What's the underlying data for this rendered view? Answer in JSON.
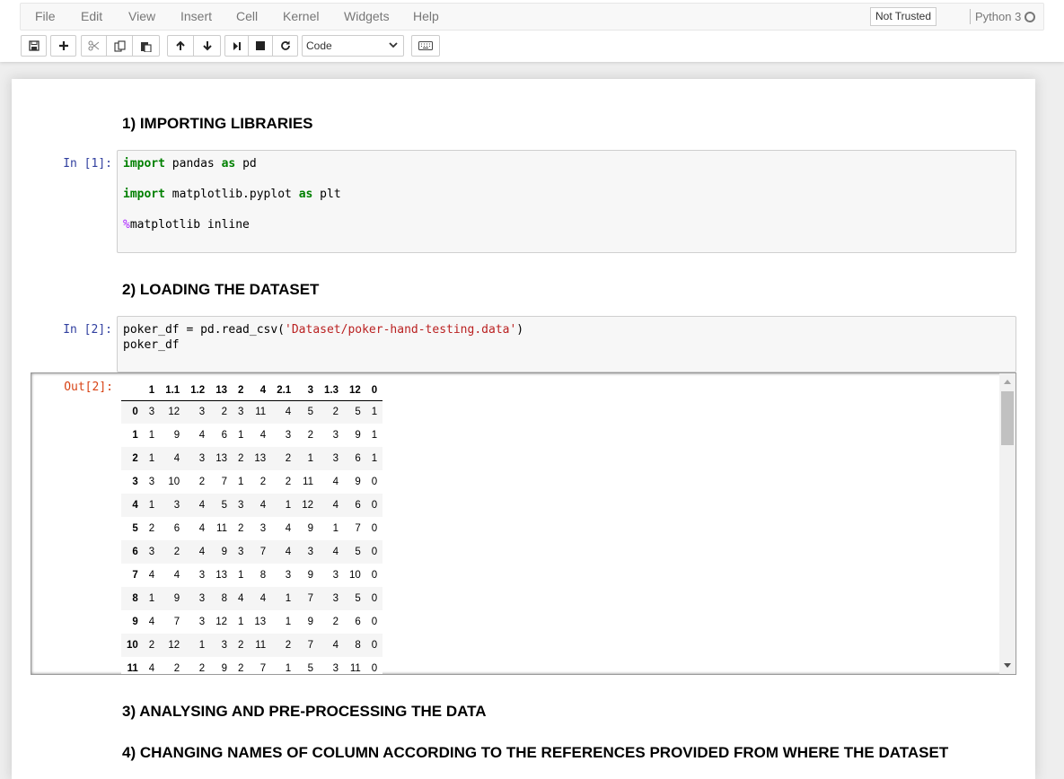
{
  "menu": {
    "items": [
      "File",
      "Edit",
      "View",
      "Insert",
      "Cell",
      "Kernel",
      "Widgets",
      "Help"
    ],
    "trust_label": "Not Trusted",
    "kernel_name": "Python 3"
  },
  "toolbar": {
    "cell_type": "Code",
    "buttons": [
      "save-icon",
      "plus-icon",
      "cut-icon",
      "copy-icon",
      "paste-icon",
      "arrow-up-icon",
      "arrow-down-icon",
      "run-icon",
      "stop-icon",
      "restart-icon",
      "keyboard-icon"
    ]
  },
  "cells": {
    "h1": "1) IMPORTING LIBRARIES",
    "in1_prompt": "In [1]:",
    "h2": "2) LOADING THE DATASET",
    "in2_prompt": "In [2]:",
    "out2_prompt": "Out[2]:",
    "h3": "3) ANALYSING AND PRE-PROCESSING THE DATA",
    "h4": "4) CHANGING NAMES OF COLUMN ACCORDING TO THE REFERENCES PROVIDED FROM WHERE THE DATASET"
  },
  "code1": {
    "l1_kw": "import",
    "l1_mod": " pandas ",
    "l1_as": "as",
    "l1_alias": " pd",
    "l2_kw": "import",
    "l2_mod": " matplotlib.pyplot ",
    "l2_as": "as",
    "l2_alias": " plt",
    "l3_magic": "%",
    "l3_rest": "matplotlib inline"
  },
  "code2": {
    "l1_pre": "poker_df = pd.read_csv(",
    "l1_str": "'Dataset/poker-hand-testing.data'",
    "l1_post": ")",
    "l2": "poker_df"
  },
  "dataframe": {
    "columns": [
      "",
      "1",
      "1.1",
      "1.2",
      "13",
      "2",
      "4",
      "2.1",
      "3",
      "1.3",
      "12",
      "0"
    ],
    "rows": [
      [
        "0",
        "3",
        "12",
        "3",
        "2",
        "3",
        "11",
        "4",
        "5",
        "2",
        "5",
        "1"
      ],
      [
        "1",
        "1",
        "9",
        "4",
        "6",
        "1",
        "4",
        "3",
        "2",
        "3",
        "9",
        "1"
      ],
      [
        "2",
        "1",
        "4",
        "3",
        "13",
        "2",
        "13",
        "2",
        "1",
        "3",
        "6",
        "1"
      ],
      [
        "3",
        "3",
        "10",
        "2",
        "7",
        "1",
        "2",
        "2",
        "11",
        "4",
        "9",
        "0"
      ],
      [
        "4",
        "1",
        "3",
        "4",
        "5",
        "3",
        "4",
        "1",
        "12",
        "4",
        "6",
        "0"
      ],
      [
        "5",
        "2",
        "6",
        "4",
        "11",
        "2",
        "3",
        "4",
        "9",
        "1",
        "7",
        "0"
      ],
      [
        "6",
        "3",
        "2",
        "4",
        "9",
        "3",
        "7",
        "4",
        "3",
        "4",
        "5",
        "0"
      ],
      [
        "7",
        "4",
        "4",
        "3",
        "13",
        "1",
        "8",
        "3",
        "9",
        "3",
        "10",
        "0"
      ],
      [
        "8",
        "1",
        "9",
        "3",
        "8",
        "4",
        "4",
        "1",
        "7",
        "3",
        "5",
        "0"
      ],
      [
        "9",
        "4",
        "7",
        "3",
        "12",
        "1",
        "13",
        "1",
        "9",
        "2",
        "6",
        "0"
      ],
      [
        "10",
        "2",
        "12",
        "1",
        "3",
        "2",
        "11",
        "2",
        "7",
        "4",
        "8",
        "0"
      ],
      [
        "11",
        "4",
        "2",
        "2",
        "9",
        "2",
        "7",
        "1",
        "5",
        "3",
        "11",
        "0"
      ]
    ]
  },
  "colors": {
    "in_prompt": "#303f9f",
    "out_prompt": "#d84315",
    "keyword": "#008000",
    "magic": "#aa22ff",
    "string": "#ba2121"
  }
}
